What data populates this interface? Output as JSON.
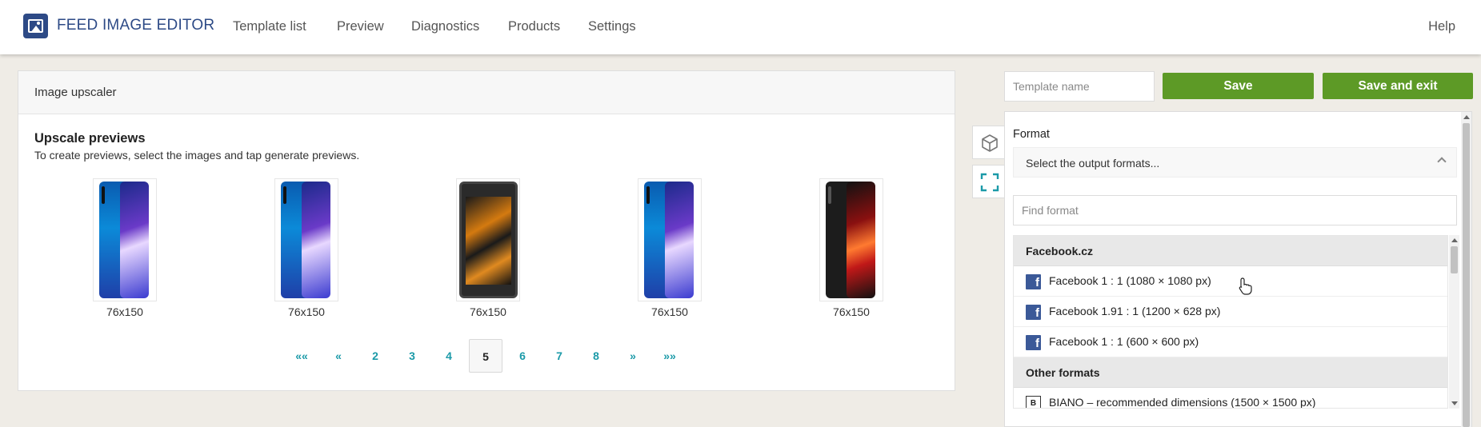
{
  "app": {
    "title": "FEED IMAGE EDITOR",
    "brand_color": "#2d4a86"
  },
  "nav": {
    "items": [
      "Template list",
      "Preview",
      "Diagnostics",
      "Products",
      "Settings"
    ],
    "help": "Help"
  },
  "left_panel": {
    "header": "Image upscaler",
    "section_title": "Upscale previews",
    "section_desc": "To create previews, select the images and tap generate previews.",
    "thumbnails": [
      {
        "label": "76x150",
        "style": "blue-gradient"
      },
      {
        "label": "76x150",
        "style": "blue-gradient"
      },
      {
        "label": "76x150",
        "style": "rugged-orange"
      },
      {
        "label": "76x150",
        "style": "blue-gradient"
      },
      {
        "label": "76x150",
        "style": "black-red"
      }
    ],
    "pagination": {
      "items": [
        "«« ",
        "«",
        "2",
        "3",
        "4",
        "5",
        "6",
        "7",
        "8",
        "»",
        "»»"
      ],
      "active": "5"
    }
  },
  "tools": {
    "icons": [
      "cube-icon",
      "fullscreen-icon"
    ]
  },
  "right_panel": {
    "template_name_placeholder": "Template name",
    "save_label": "Save",
    "save_exit_label": "Save and exit",
    "accent_color": "#5d9a26",
    "format_label": "Format",
    "format_select_placeholder": "Select the output formats...",
    "find_placeholder": "Find format",
    "groups": [
      {
        "name": "Facebook.cz",
        "items": [
          {
            "icon": "facebook-icon",
            "label": "Facebook 1 : 1 (1080 × 1080 px)"
          },
          {
            "icon": "facebook-icon",
            "label": "Facebook 1.91 : 1 (1200 × 628 px)"
          },
          {
            "icon": "facebook-icon",
            "label": "Facebook 1 : 1 (600 × 600 px)"
          }
        ]
      },
      {
        "name": "Other formats",
        "items": [
          {
            "icon": "biano-icon",
            "label": "BIANO – recommended dimensions (1500 × 1500 px)"
          }
        ]
      }
    ]
  }
}
